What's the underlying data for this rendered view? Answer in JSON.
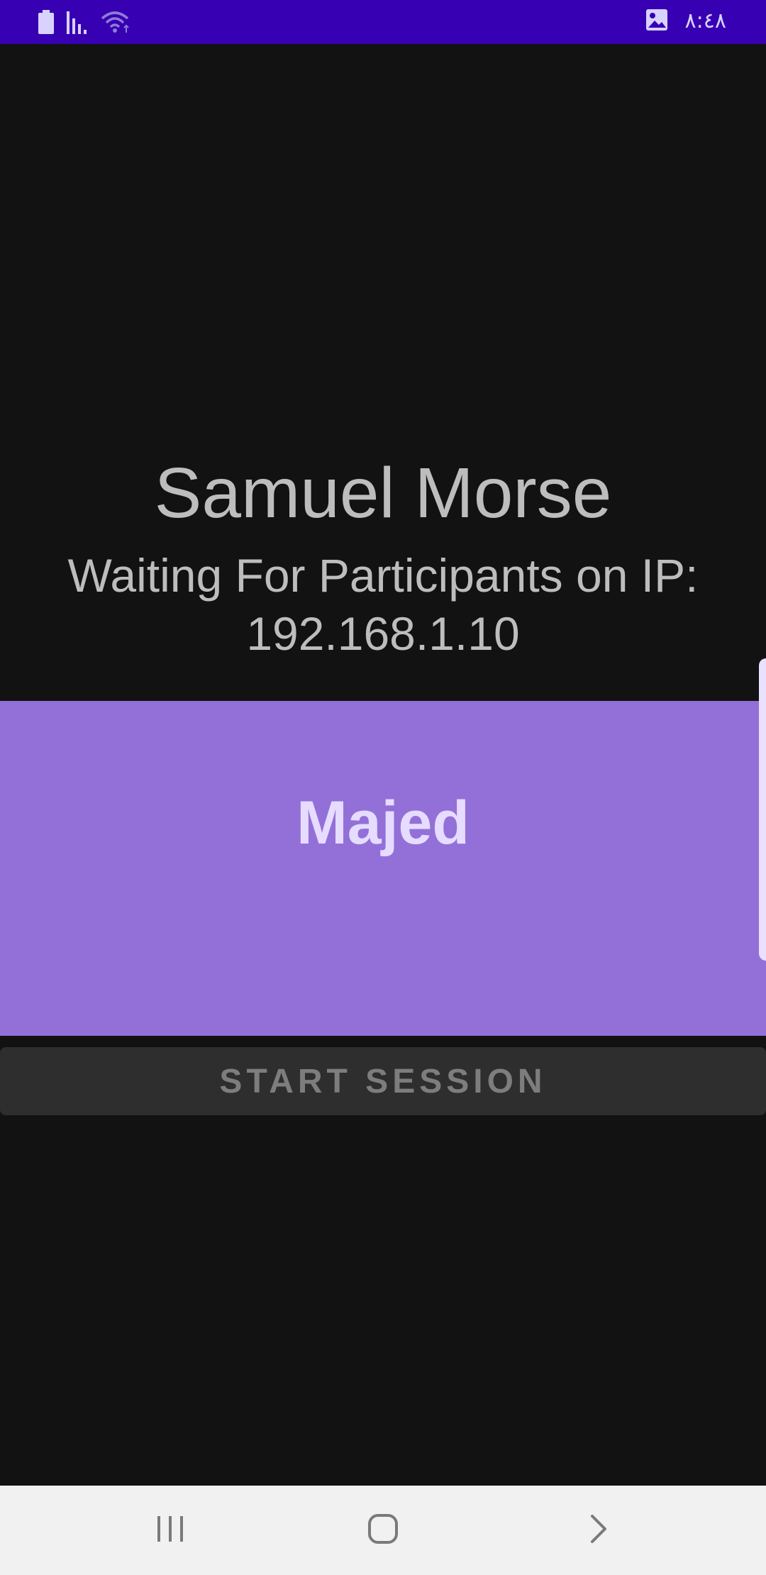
{
  "status_bar": {
    "clock": "٨:٤٨",
    "icons": [
      "battery-icon",
      "signal-icon",
      "wifi-icon",
      "image-notification-icon"
    ],
    "background": "#3700b3"
  },
  "main": {
    "title": "Samuel Morse",
    "waiting_line1": "Waiting For Participants on IP:",
    "waiting_line2": "192.168.1.10"
  },
  "participants": {
    "items": [
      {
        "name": "Majed"
      }
    ],
    "background": "#9370d8"
  },
  "actions": {
    "start_label": "START SESSION"
  },
  "nav_bar": {
    "icons": [
      "recents-icon",
      "home-icon",
      "back-icon"
    ]
  }
}
